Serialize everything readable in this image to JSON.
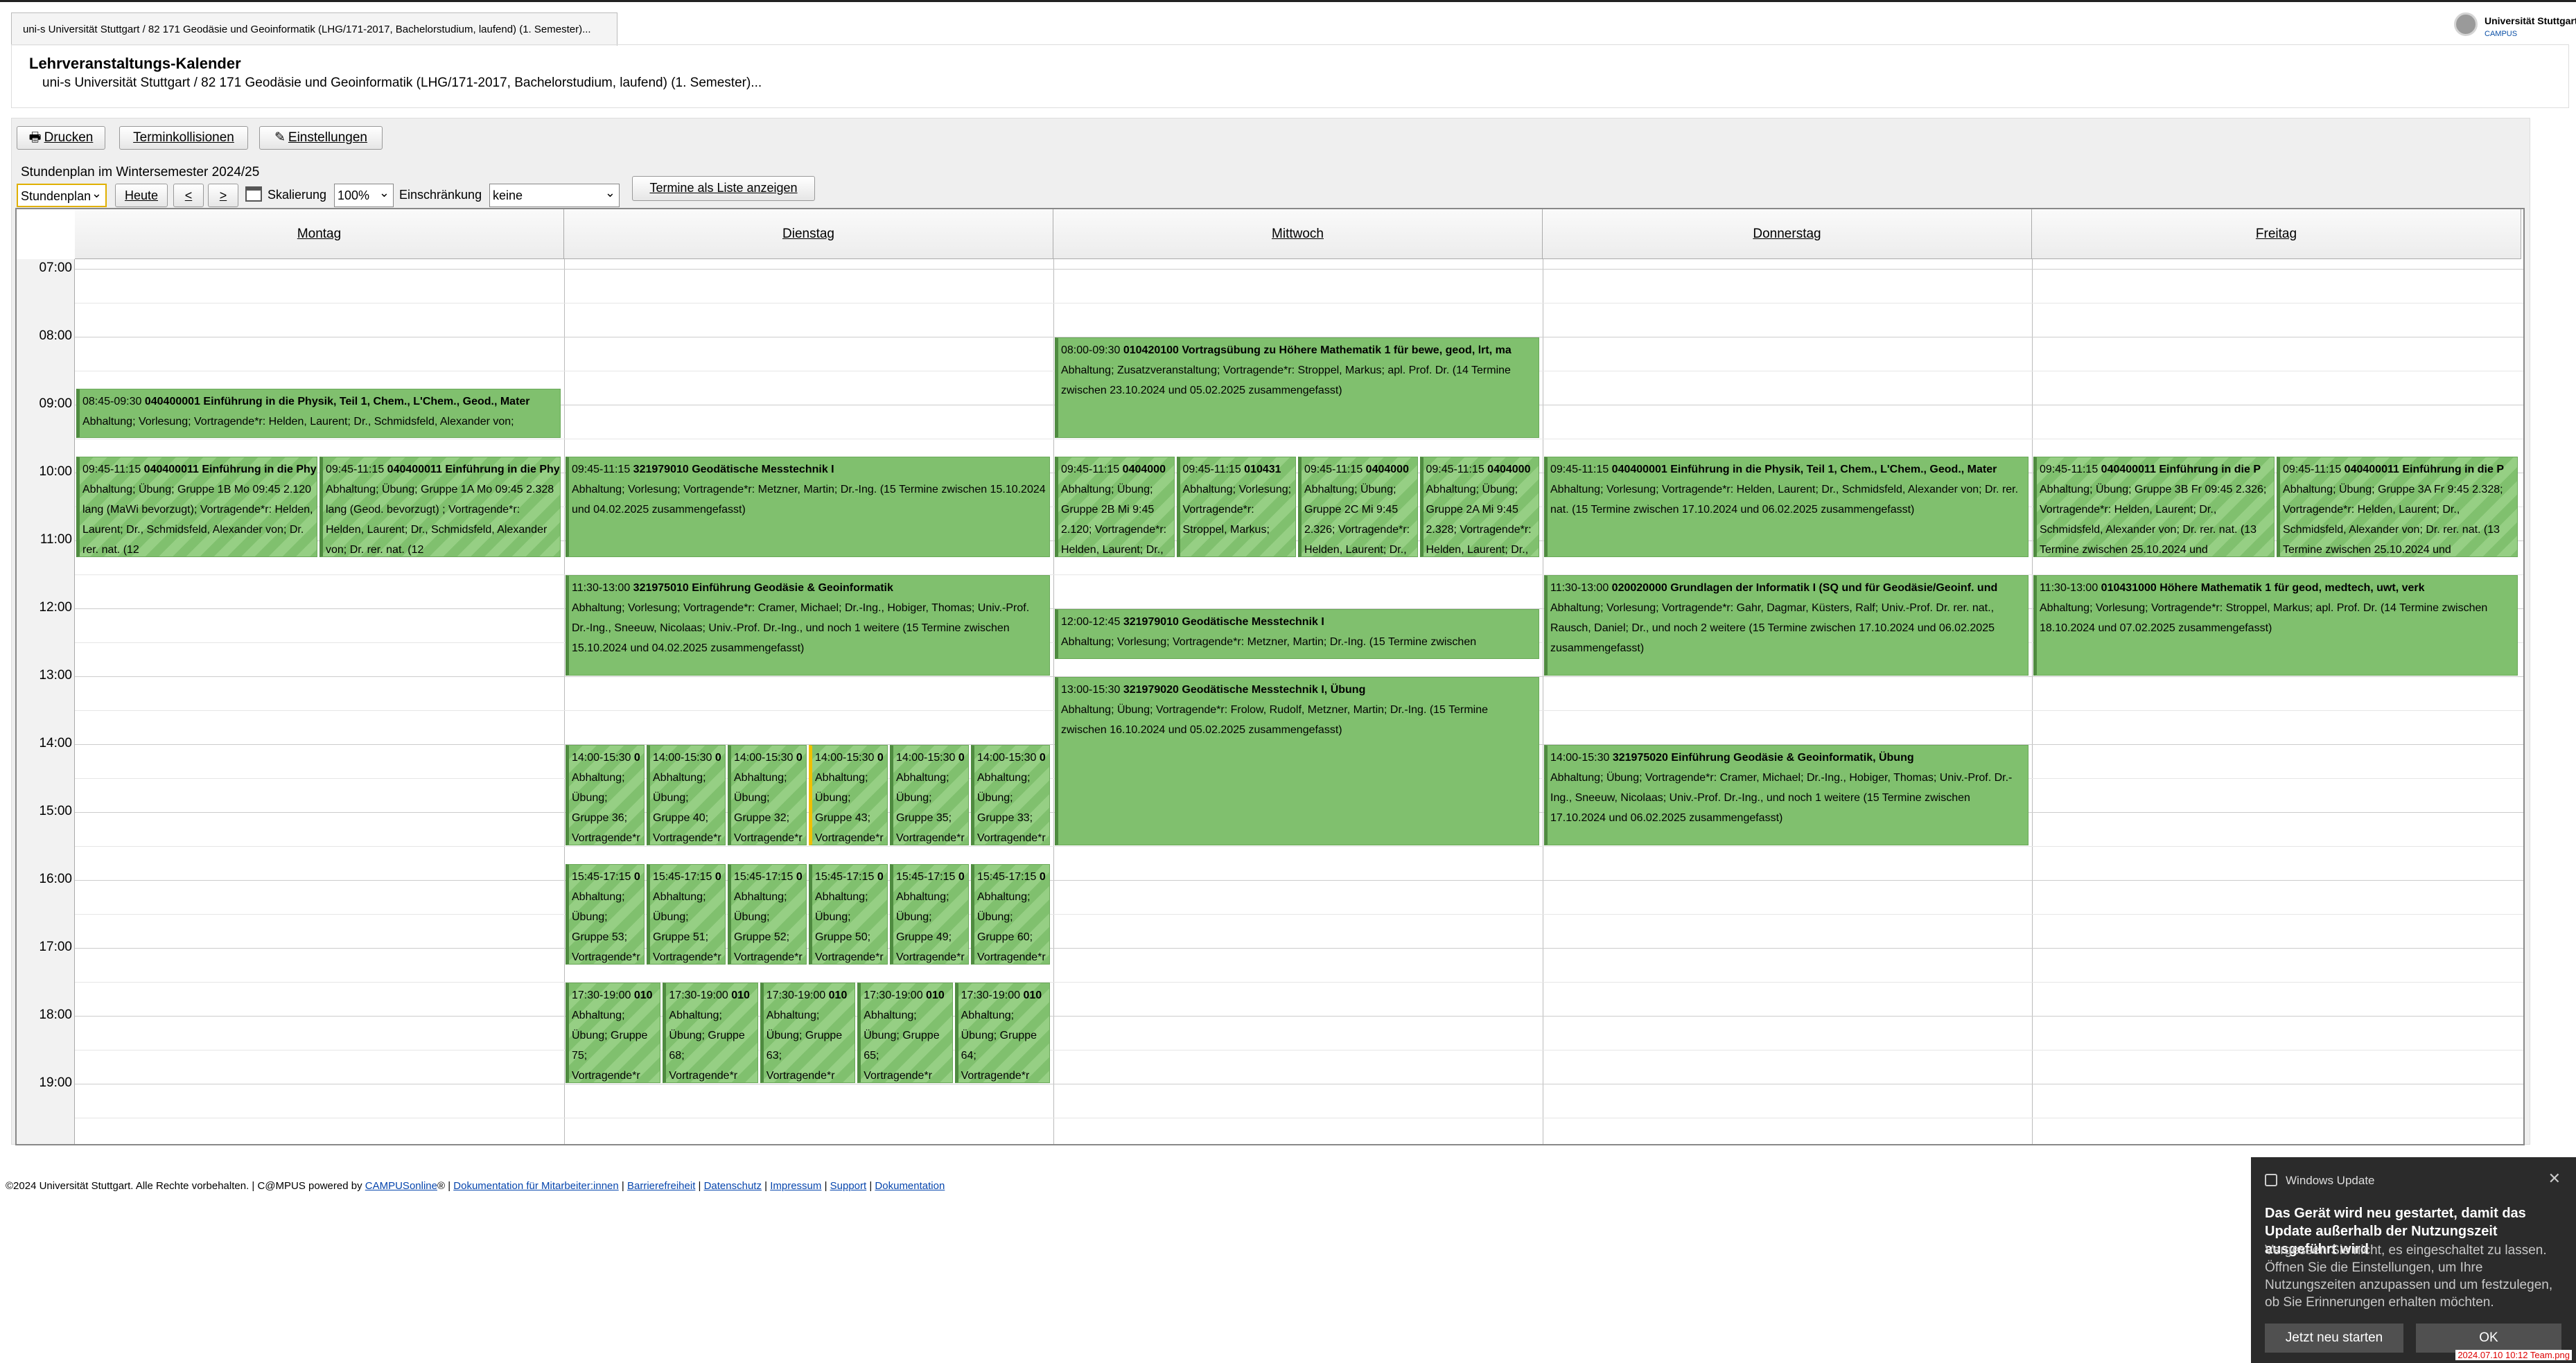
{
  "window": {
    "tab_title": "uni-s Universität Stuttgart / 82 171 Geodäsie und Geoinformatik (LHG/171-2017, Bachelorstudium, laufend) (1. Semester)...",
    "logo_line1": "Universität Stuttgart",
    "logo_line2": "CAMPUS"
  },
  "header": {
    "title": "Lehrveranstaltungs-Kalender",
    "subtitle": "uni-s Universität Stuttgart / 82 171 Geodäsie und Geoinformatik (LHG/171-2017, Bachelorstudium, laufend) (1. Semester)..."
  },
  "toolbar": {
    "print": "Drucken",
    "collisions": "Terminkollisionen",
    "settings": "Einstellungen"
  },
  "controls": {
    "semester_label": "Stundenplan im Wintersemester 2024/25",
    "view_select": "Stundenplan",
    "today": "Heute",
    "prev": "<",
    "next": ">",
    "scale_label": "Skalierung",
    "scale_value": "100%",
    "restriction_label": "Einschränkung",
    "restriction_value": "keine",
    "list_button": "Termine als Liste anzeigen"
  },
  "calendar": {
    "days": [
      "Montag",
      "Dienstag",
      "Mittwoch",
      "Donnerstag",
      "Freitag"
    ],
    "hours": [
      "07:00",
      "08:00",
      "09:00",
      "10:00",
      "11:00",
      "12:00",
      "13:00",
      "14:00",
      "15:00",
      "16:00",
      "17:00",
      "18:00",
      "19:00"
    ],
    "events": [
      {
        "day": 0,
        "start": 8.75,
        "end": 9.5,
        "col": 0,
        "ncol": 1,
        "striped": false,
        "time": "08:45-09:30",
        "code": "040400001",
        "title": "Einführung in die Physik, Teil 1, Chem., L'Chem., Geod., Mater",
        "detail": "Abhaltung; Vorlesung; Vortragende*r: Helden, Laurent; Dr., Schmidsfeld, Alexander von;"
      },
      {
        "day": 0,
        "start": 9.75,
        "end": 11.25,
        "col": 0,
        "ncol": 2,
        "striped": true,
        "time": "09:45-11:15",
        "code": "040400011",
        "title": "Einführung in die Physik",
        "detail": "Abhaltung; Übung; Gruppe 1B Mo 09:45 2.120 lang (MaWi bevorzugt); Vortragende*r: Helden, Laurent; Dr., Schmidsfeld, Alexander von; Dr. rer. nat. (12"
      },
      {
        "day": 0,
        "start": 9.75,
        "end": 11.25,
        "col": 1,
        "ncol": 2,
        "striped": true,
        "time": "09:45-11:15",
        "code": "040400011",
        "title": "Einführung in die Physik",
        "detail": "Abhaltung; Übung; Gruppe 1A Mo 09:45 2.328 lang (Geod. bevorzugt) ; Vortragende*r: Helden, Laurent; Dr., Schmidsfeld, Alexander von; Dr. rer. nat. (12"
      },
      {
        "day": 1,
        "start": 9.75,
        "end": 11.25,
        "col": 0,
        "ncol": 1,
        "striped": false,
        "time": "09:45-11:15",
        "code": "321979010",
        "title": "Geodätische Messtechnik I",
        "detail": "Abhaltung; Vorlesung; Vortragende*r: Metzner, Martin; Dr.-Ing. (15 Termine zwischen 15.10.2024 und 04.02.2025 zusammengefasst)"
      },
      {
        "day": 1,
        "start": 11.5,
        "end": 13.0,
        "col": 0,
        "ncol": 1,
        "striped": false,
        "time": "11:30-13:00",
        "code": "321975010",
        "title": "Einführung Geodäsie & Geoinformatik",
        "detail": "Abhaltung; Vorlesung; Vortragende*r: Cramer, Michael; Dr.-Ing., Hobiger, Thomas; Univ.-Prof. Dr.-Ing., Sneeuw, Nicolaas; Univ.-Prof. Dr.-Ing., und noch 1 weitere (15 Termine zwischen 15.10.2024 und 04.02.2025 zusammengefasst)"
      },
      {
        "day": 1,
        "start": 14.0,
        "end": 15.5,
        "col": 0,
        "ncol": 6,
        "striped": true,
        "highlight": false,
        "time": "14:00-15:30",
        "code": "0",
        "title": "",
        "detail": "Abhaltung; Übung; Gruppe 36; Vortragende*r"
      },
      {
        "day": 1,
        "start": 14.0,
        "end": 15.5,
        "col": 1,
        "ncol": 6,
        "striped": true,
        "highlight": false,
        "time": "14:00-15:30",
        "code": "0",
        "title": "",
        "detail": "Abhaltung; Übung; Gruppe 40; Vortragende*r"
      },
      {
        "day": 1,
        "start": 14.0,
        "end": 15.5,
        "col": 2,
        "ncol": 6,
        "striped": true,
        "highlight": false,
        "time": "14:00-15:30",
        "code": "0",
        "title": "",
        "detail": "Abhaltung; Übung; Gruppe 32; Vortragende*r"
      },
      {
        "day": 1,
        "start": 14.0,
        "end": 15.5,
        "col": 3,
        "ncol": 6,
        "striped": true,
        "highlight": true,
        "time": "14:00-15:30",
        "code": "0",
        "title": "",
        "detail": "Abhaltung; Übung; Gruppe 43; Vortragende*r"
      },
      {
        "day": 1,
        "start": 14.0,
        "end": 15.5,
        "col": 4,
        "ncol": 6,
        "striped": true,
        "highlight": false,
        "time": "14:00-15:30",
        "code": "0",
        "title": "",
        "detail": "Abhaltung; Übung; Gruppe 35; Vortragende*r"
      },
      {
        "day": 1,
        "start": 14.0,
        "end": 15.5,
        "col": 5,
        "ncol": 6,
        "striped": true,
        "highlight": false,
        "time": "14:00-15:30",
        "code": "0",
        "title": "",
        "detail": "Abhaltung; Übung; Gruppe 33; Vortragende*r"
      },
      {
        "day": 1,
        "start": 15.75,
        "end": 17.25,
        "col": 0,
        "ncol": 6,
        "striped": true,
        "time": "15:45-17:15",
        "code": "0",
        "title": "",
        "detail": "Abhaltung; Übung; Gruppe 53; Vortragende*r"
      },
      {
        "day": 1,
        "start": 15.75,
        "end": 17.25,
        "col": 1,
        "ncol": 6,
        "striped": true,
        "time": "15:45-17:15",
        "code": "0",
        "title": "",
        "detail": "Abhaltung; Übung; Gruppe 51; Vortragende*r"
      },
      {
        "day": 1,
        "start": 15.75,
        "end": 17.25,
        "col": 2,
        "ncol": 6,
        "striped": true,
        "time": "15:45-17:15",
        "code": "0",
        "title": "",
        "detail": "Abhaltung; Übung; Gruppe 52; Vortragende*r"
      },
      {
        "day": 1,
        "start": 15.75,
        "end": 17.25,
        "col": 3,
        "ncol": 6,
        "striped": true,
        "time": "15:45-17:15",
        "code": "0",
        "title": "",
        "detail": "Abhaltung; Übung; Gruppe 50; Vortragende*r"
      },
      {
        "day": 1,
        "start": 15.75,
        "end": 17.25,
        "col": 4,
        "ncol": 6,
        "striped": true,
        "time": "15:45-17:15",
        "code": "0",
        "title": "",
        "detail": "Abhaltung; Übung; Gruppe 49; Vortragende*r"
      },
      {
        "day": 1,
        "start": 15.75,
        "end": 17.25,
        "col": 5,
        "ncol": 6,
        "striped": true,
        "time": "15:45-17:15",
        "code": "0",
        "title": "",
        "detail": "Abhaltung; Übung; Gruppe 60; Vortragende*r"
      },
      {
        "day": 1,
        "start": 17.5,
        "end": 19.0,
        "col": 0,
        "ncol": 5,
        "striped": true,
        "time": "17:30-19:00",
        "code": "010",
        "title": "",
        "detail": "Abhaltung; Übung; Gruppe 75; Vortragende*r"
      },
      {
        "day": 1,
        "start": 17.5,
        "end": 19.0,
        "col": 1,
        "ncol": 5,
        "striped": true,
        "time": "17:30-19:00",
        "code": "010",
        "title": "",
        "detail": "Abhaltung; Übung; Gruppe 68; Vortragende*r"
      },
      {
        "day": 1,
        "start": 17.5,
        "end": 19.0,
        "col": 2,
        "ncol": 5,
        "striped": true,
        "time": "17:30-19:00",
        "code": "010",
        "title": "",
        "detail": "Abhaltung; Übung; Gruppe 63; Vortragende*r"
      },
      {
        "day": 1,
        "start": 17.5,
        "end": 19.0,
        "col": 3,
        "ncol": 5,
        "striped": true,
        "time": "17:30-19:00",
        "code": "010",
        "title": "",
        "detail": "Abhaltung; Übung; Gruppe 65; Vortragende*r"
      },
      {
        "day": 1,
        "start": 17.5,
        "end": 19.0,
        "col": 4,
        "ncol": 5,
        "striped": true,
        "time": "17:30-19:00",
        "code": "010",
        "title": "",
        "detail": "Abhaltung; Übung; Gruppe 64; Vortragende*r"
      },
      {
        "day": 2,
        "start": 8.0,
        "end": 9.5,
        "col": 0,
        "ncol": 1,
        "striped": false,
        "time": "08:00-09:30",
        "code": "010420100",
        "title": "Vortragsübung zu Höhere Mathematik 1 für bewe, geod, lrt, ma",
        "detail": "Abhaltung; Zusatzveranstaltung; Vortragende*r: Stroppel, Markus; apl. Prof. Dr. (14 Termine zwischen 23.10.2024 und 05.02.2025 zusammengefasst)"
      },
      {
        "day": 2,
        "start": 9.75,
        "end": 11.25,
        "col": 0,
        "ncol": 4,
        "striped": true,
        "time": "09:45-11:15",
        "code": "0404000",
        "title": "",
        "detail": "Abhaltung; Übung; Gruppe 2B Mi 9:45 2.120; Vortragende*r: Helden, Laurent; Dr.,"
      },
      {
        "day": 2,
        "start": 9.75,
        "end": 11.25,
        "col": 1,
        "ncol": 4,
        "striped": true,
        "time": "09:45-11:15",
        "code": "010431",
        "title": "",
        "detail": "Abhaltung; Vorlesung; Vortragende*r: Stroppel, Markus;"
      },
      {
        "day": 2,
        "start": 9.75,
        "end": 11.25,
        "col": 2,
        "ncol": 4,
        "striped": true,
        "time": "09:45-11:15",
        "code": "0404000",
        "title": "",
        "detail": "Abhaltung; Übung; Gruppe 2C Mi 9:45 2.326; Vortragende*r: Helden, Laurent; Dr.,"
      },
      {
        "day": 2,
        "start": 9.75,
        "end": 11.25,
        "col": 3,
        "ncol": 4,
        "striped": true,
        "time": "09:45-11:15",
        "code": "0404000",
        "title": "",
        "detail": "Abhaltung; Übung; Gruppe 2A Mi 9:45 2.328; Vortragende*r: Helden, Laurent; Dr.,"
      },
      {
        "day": 2,
        "start": 12.0,
        "end": 12.75,
        "col": 0,
        "ncol": 1,
        "striped": false,
        "time": "12:00-12:45",
        "code": "321979010",
        "title": "Geodätische Messtechnik I",
        "detail": "Abhaltung; Vorlesung; Vortragende*r: Metzner, Martin; Dr.-Ing. (15 Termine zwischen"
      },
      {
        "day": 2,
        "start": 13.0,
        "end": 15.5,
        "col": 0,
        "ncol": 1,
        "striped": false,
        "time": "13:00-15:30",
        "code": "321979020",
        "title": "Geodätische Messtechnik I, Übung",
        "detail": "Abhaltung; Übung; Vortragende*r: Frolow, Rudolf, Metzner, Martin; Dr.-Ing. (15 Termine zwischen 16.10.2024 und 05.02.2025 zusammengefasst)"
      },
      {
        "day": 3,
        "start": 9.75,
        "end": 11.25,
        "col": 0,
        "ncol": 1,
        "striped": false,
        "time": "09:45-11:15",
        "code": "040400001",
        "title": "Einführung in die Physik, Teil 1, Chem., L'Chem., Geod., Mater",
        "detail": "Abhaltung; Vorlesung; Vortragende*r: Helden, Laurent; Dr., Schmidsfeld, Alexander von; Dr. rer. nat. (15 Termine zwischen 17.10.2024 und 06.02.2025 zusammengefasst)"
      },
      {
        "day": 3,
        "start": 11.5,
        "end": 13.0,
        "col": 0,
        "ncol": 1,
        "striped": false,
        "time": "11:30-13:00",
        "code": "020020000",
        "title": "Grundlagen der Informatik I (SQ und für Geodäsie/Geoinf. und",
        "detail": "Abhaltung; Vorlesung; Vortragende*r: Gahr, Dagmar, Küsters, Ralf; Univ.-Prof. Dr. rer. nat., Rausch, Daniel; Dr., und noch 2 weitere (15 Termine zwischen 17.10.2024 und 06.02.2025 zusammengefasst)"
      },
      {
        "day": 3,
        "start": 14.0,
        "end": 15.5,
        "col": 0,
        "ncol": 1,
        "striped": false,
        "time": "14:00-15:30",
        "code": "321975020",
        "title": "Einführung Geodäsie & Geoinformatik, Übung",
        "detail": "Abhaltung; Übung; Vortragende*r: Cramer, Michael; Dr.-Ing., Hobiger, Thomas; Univ.-Prof. Dr.-Ing., Sneeuw, Nicolaas; Univ.-Prof. Dr.-Ing., und noch 1 weitere (15 Termine zwischen 17.10.2024 und 06.02.2025 zusammengefasst)"
      },
      {
        "day": 4,
        "start": 9.75,
        "end": 11.25,
        "col": 0,
        "ncol": 2,
        "striped": true,
        "time": "09:45-11:15",
        "code": "040400011",
        "title": "Einführung in die P",
        "detail": "Abhaltung; Übung; Gruppe 3B Fr 09:45 2.326; Vortragende*r: Helden, Laurent; Dr., Schmidsfeld, Alexander von; Dr. rer. nat. (13 Termine zwischen 25.10.2024 und"
      },
      {
        "day": 4,
        "start": 9.75,
        "end": 11.25,
        "col": 1,
        "ncol": 2,
        "striped": true,
        "time": "09:45-11:15",
        "code": "040400011",
        "title": "Einführung in die P",
        "detail": "Abhaltung; Übung; Gruppe 3A Fr 9:45 2.328; Vortragende*r: Helden, Laurent; Dr., Schmidsfeld, Alexander von; Dr. rer. nat. (13 Termine zwischen 25.10.2024 und"
      },
      {
        "day": 4,
        "start": 11.5,
        "end": 13.0,
        "col": 0,
        "ncol": 1,
        "striped": false,
        "time": "11:30-13:00",
        "code": "010431000",
        "title": "Höhere Mathematik 1 für geod, medtech, uwt, verk",
        "detail": "Abhaltung; Vorlesung; Vortragende*r: Stroppel, Markus; apl. Prof. Dr. (14 Termine zwischen 18.10.2024 und 07.02.2025 zusammengefasst)"
      }
    ]
  },
  "footer": {
    "copyright": "©2024 Universität Stuttgart. Alle Rechte vorbehalten. | C@MPUS powered by ",
    "campus_link": "CAMPUSonline",
    "reg": "® | ",
    "links": [
      "Dokumentation für Mitarbeiter:innen",
      "Barrierefreiheit",
      "Datenschutz",
      "Impressum",
      "Support",
      "Dokumentation"
    ]
  },
  "notification": {
    "app": "Windows Update",
    "heading": "Das Gerät wird neu gestartet, damit das Update außerhalb der Nutzungszeit ausgeführt wird",
    "body": "Vergessen Sie nicht, es eingeschaltet zu lassen. Öffnen Sie die Einstellungen, um Ihre Nutzungszeiten anzupassen und um festzulegen, ob Sie Erinnerungen erhalten möchten.",
    "restart": "Jetzt neu starten",
    "ok": "OK"
  },
  "stamp": "2024.07.10 10:12 Team.png"
}
